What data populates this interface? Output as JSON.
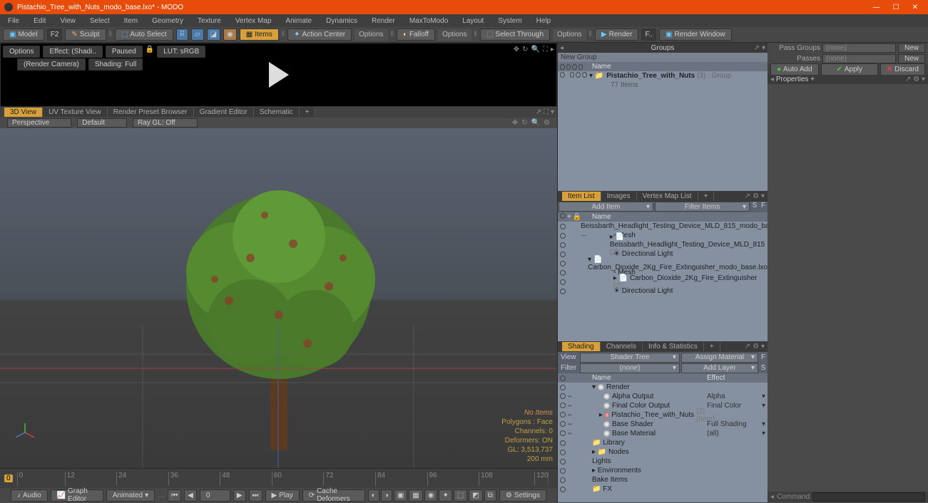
{
  "title": "Pistachio_Tree_with_Nuts_modo_base.lxo* - MODO",
  "menu": [
    "File",
    "Edit",
    "View",
    "Select",
    "Item",
    "Geometry",
    "Texture",
    "Vertex Map",
    "Animate",
    "Dynamics",
    "Render",
    "MaxToModo",
    "Layout",
    "System",
    "Help"
  ],
  "toolbar": {
    "model": "Model",
    "f2": "F2",
    "sculpt": "Sculpt",
    "autoselect": "Auto Select",
    "items": "Items",
    "actioncenter": "Action Center",
    "options1": "Options",
    "falloff": "Falloff",
    "options2": "Options",
    "selectthrough": "Select Through",
    "options3": "Options",
    "render": "Render",
    "renderwindow": "Render Window"
  },
  "preview": {
    "options": "Options",
    "effect": "Effect: (Shadi..",
    "paused": "Paused",
    "lut": "LUT: sRGB",
    "camera": "(Render Camera)",
    "shading": "Shading: Full"
  },
  "view_tabs": [
    "3D View",
    "UV Texture View",
    "Render Preset Browser",
    "Gradient Editor",
    "Schematic"
  ],
  "vp_drop": {
    "perspective": "Perspective",
    "default": "Default",
    "raygl": "Ray GL: Off"
  },
  "vp_stats": {
    "noitems": "No Items",
    "poly": "Polygons : Face",
    "chan": "Channels: 0",
    "def": "Deformers: ON",
    "gl": "GL: 3,513,737",
    "mm": "200 mm"
  },
  "timeline_ticks": [
    "0",
    "12",
    "24",
    "36",
    "48",
    "60",
    "72",
    "84",
    "96",
    "108",
    "120"
  ],
  "bottom": {
    "audio": "Audio",
    "graph": "Graph Editor",
    "animated": "Animated",
    "frame": "0",
    "play": "Play",
    "cache": "Cache Deformers",
    "settings": "Settings"
  },
  "groups": {
    "title": "Groups",
    "new": "New Group",
    "colname": "Name",
    "item": "Pistachio_Tree_with_Nuts",
    "count": "(3)",
    "type": ": Group",
    "sub": "77 Items"
  },
  "itemlist": {
    "tabs": [
      "Item List",
      "Images",
      "Vertex Map List"
    ],
    "add": "Add Item",
    "filter": "Filter Items",
    "colname": "Name",
    "items": [
      {
        "name": "Beissbarth_Headlight_Testing_Device_MLD_815_modo_ba ...",
        "indent": 0,
        "exp": "▾"
      },
      {
        "name": "Mesh",
        "indent": 1,
        "mesh": true
      },
      {
        "name": "Beissbarth_Headlight_Testing_Device_MLD_815",
        "suffix": "(2)",
        "indent": 1,
        "exp": "▸"
      },
      {
        "name": "Directional Light",
        "indent": 1,
        "light": true
      },
      {
        "name": "Carbon_Dioxide_2Kg_Fire_Extinguisher_modo_base.lxo",
        "indent": 0,
        "exp": "▾"
      },
      {
        "name": "Mesh",
        "indent": 1,
        "mesh": true
      },
      {
        "name": "Carbon_Dioxide_2Kg_Fire_Extinguisher",
        "suffix": "(2)",
        "indent": 1,
        "exp": "▸"
      },
      {
        "name": "Directional Light",
        "indent": 1,
        "light": true
      }
    ]
  },
  "shading": {
    "tabs": [
      "Shading",
      "Channels",
      "Info & Statistics"
    ],
    "view": "View",
    "shadertree": "Shader Tree",
    "assign": "Assign Material",
    "filterlbl": "Filter",
    "filterval": "(none)",
    "addlayer": "Add Layer",
    "cols": {
      "name": "Name",
      "effect": "Effect"
    },
    "rows": [
      {
        "name": "Render",
        "indent": 0,
        "exp": "▾",
        "ball": "b"
      },
      {
        "name": "Alpha Output",
        "indent": 1,
        "effect": "Alpha",
        "ball": "b"
      },
      {
        "name": "Final Color Output",
        "indent": 1,
        "effect": "Final Color",
        "ball": "b"
      },
      {
        "name": "Pistachio_Tree_with_Nuts",
        "suffix": "(2) (Item)",
        "indent": 1,
        "ball": "r",
        "exp": "▸"
      },
      {
        "name": "Base Shader",
        "indent": 1,
        "effect": "Full Shading",
        "ball": "b"
      },
      {
        "name": "Base Material",
        "indent": 1,
        "effect": "(all)",
        "ball": "b"
      },
      {
        "name": "Library",
        "indent": 0,
        "folder": true
      },
      {
        "name": "Nodes",
        "indent": 0,
        "exp": "▸",
        "folder": true
      },
      {
        "name": "Lights",
        "indent": 0
      },
      {
        "name": "Environments",
        "indent": 0,
        "exp": "▸"
      },
      {
        "name": "Bake Items",
        "indent": 0
      },
      {
        "name": "FX",
        "indent": 0,
        "folder": true
      }
    ]
  },
  "farright": {
    "passgroups": "Pass Groups",
    "passes": "Passes",
    "none": "(none)",
    "new": "New",
    "autoadd": "Auto Add",
    "apply": "Apply",
    "discard": "Discard",
    "properties": "Properties",
    "command": "Command"
  }
}
